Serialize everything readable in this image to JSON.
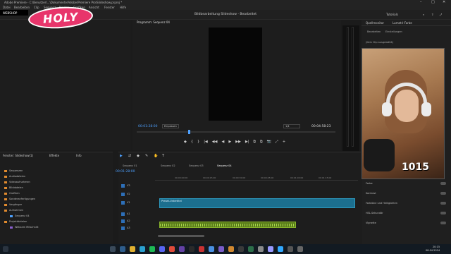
{
  "window": {
    "title": "Adobe Premiere - C:\\Benutzer\\...\\Dokumente\\Adobe\\Premiere Pro\\Slideshow.prproj *",
    "controls": [
      "–",
      "□",
      "✕"
    ]
  },
  "menu": {
    "items": [
      "Datei",
      "Bearbeiten",
      "Clip",
      "Sequenz",
      "Marken",
      "Grafiken",
      "Ansicht",
      "Fenster",
      "Hilfe"
    ]
  },
  "header": {
    "workspace_title": "Bildbearbeitung Slideshow - Bearbeitet",
    "workspace_label": "Tutorials"
  },
  "overlay": {
    "logo_text": "HOLY",
    "logo_sub": "WEBSHOP"
  },
  "program_monitor": {
    "tab": "Programm: Sequenz 04",
    "timecode_left": "00:01:28:00",
    "fit_label": "Einpassen",
    "quality_label": "1/4",
    "timecode_right": "00:04:58:23",
    "controls": [
      "◆",
      "{",
      "}",
      "|◀",
      "◀◀",
      "◀",
      "▶",
      "▶▶",
      "▶|",
      "⧉",
      "⧉",
      "📷",
      "⤢",
      "+"
    ]
  },
  "effect_controls": {
    "tabs": [
      "Quellmonitor",
      "Lumetri-Farbe"
    ],
    "subtabs": [
      "Bearbeiten",
      "Einstellungen"
    ],
    "hint": "(Kein Clip ausgewählt)",
    "webcam_overlay_number": "1015",
    "properties": [
      "Farbe",
      "Kontrast",
      "Farbtöne und Helligkeiten",
      "HSL-Sekundär",
      "Vignette"
    ]
  },
  "project_panel": {
    "tabs": [
      "Fenster: Slideshow(1)",
      "Effekte",
      "Info"
    ],
    "items": [
      "Sequenzen",
      "Audiodateien",
      "Videoaufnahmen",
      "Bilddateien",
      "Grafiken",
      "Sonderanfertigungen",
      "Vorgänger",
      "Aufnahmen",
      "Sequenz 04",
      "Projektdateien",
      "Webcam Mitschnitt"
    ]
  },
  "timeline": {
    "sequence_tabs": [
      "Sequenz 01",
      "Sequenz 02",
      "Sequenz 03",
      "Sequenz 04"
    ],
    "timecode": "00:01:28:00",
    "ruler_labels": [
      "00:00:00:00",
      "00:00:15:00",
      "00:00:30:00",
      "00:00:45:00",
      "00:01:00:00",
      "00:01:15:00"
    ],
    "tracks": [
      "V3",
      "V2",
      "V1",
      "A1",
      "A2",
      "A3"
    ],
    "video_clip_label": "Preset-Untertitel",
    "tool_icons": [
      "▶",
      "⇄",
      "◆",
      "✎",
      "✋",
      "T"
    ]
  },
  "taskbar": {
    "time": "20:15",
    "date": "08.04.2024"
  },
  "colors": {
    "accent": "#4ea1ff",
    "video_clip": "#1c6f8f",
    "audio_clip": "#5a7d1a",
    "logo": "#e8356b"
  }
}
